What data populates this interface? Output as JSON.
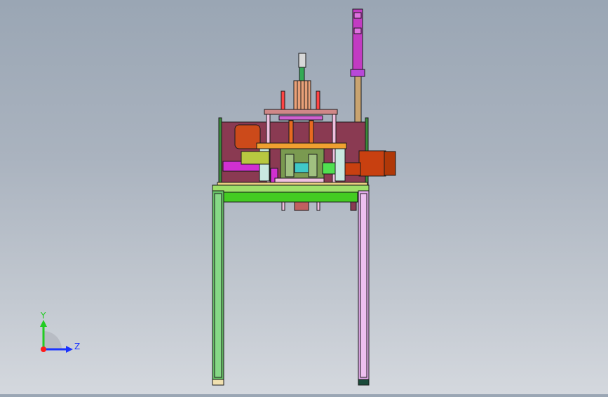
{
  "view": {
    "background_top": "#9aa6b4",
    "background_bottom": "#d4d8de"
  },
  "triad": {
    "y_label": "Y",
    "z_label": "Z",
    "y_color": "#22cc22",
    "z_color": "#1a33ff",
    "x_color": "#ff1a1a"
  }
}
